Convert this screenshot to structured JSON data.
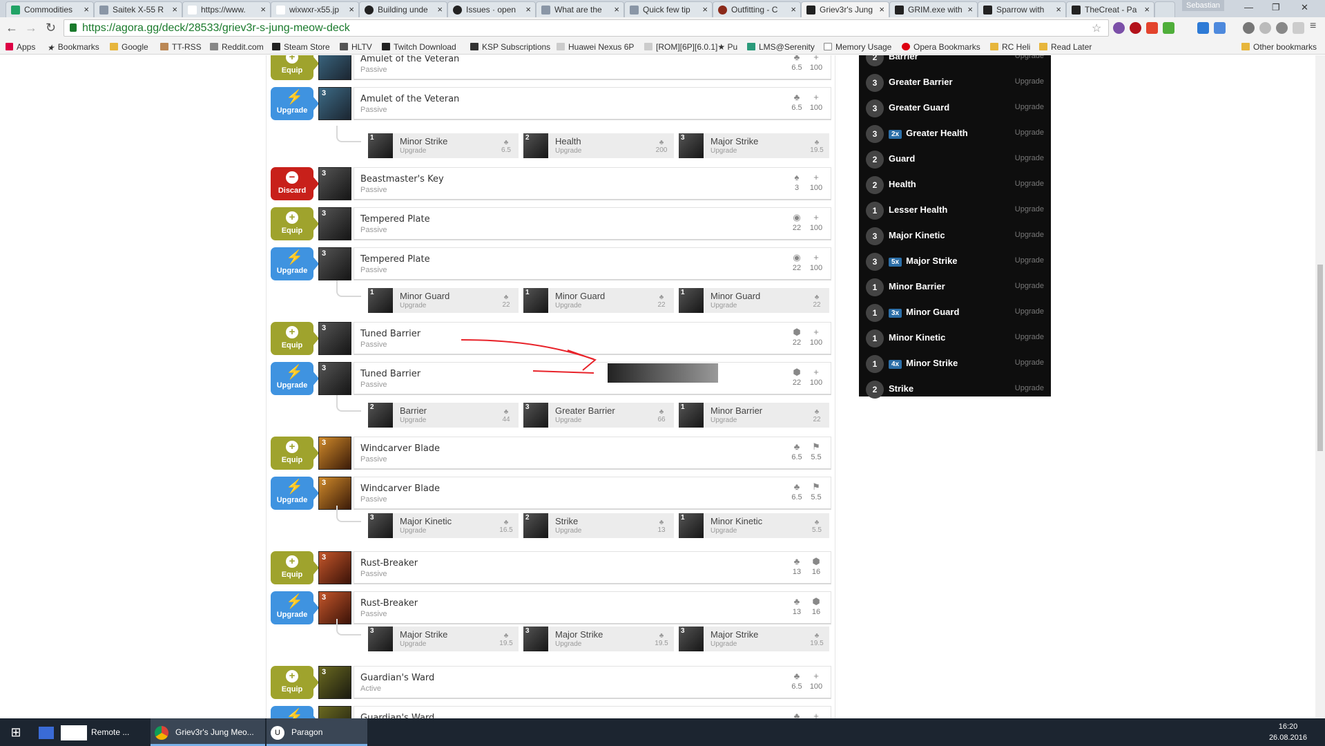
{
  "browser": {
    "tabs": [
      {
        "title": "Commodities"
      },
      {
        "title": "Saitek X-55 R"
      },
      {
        "title": "https://www."
      },
      {
        "title": "wixwxr-x55.jp"
      },
      {
        "title": "Building unde"
      },
      {
        "title": "Issues · open"
      },
      {
        "title": "What are the"
      },
      {
        "title": "Quick few tip"
      },
      {
        "title": "Outfitting - C"
      },
      {
        "title": "Griev3r's Jung"
      },
      {
        "title": "GRIM.exe with"
      },
      {
        "title": "Sparrow with"
      },
      {
        "title": "TheCreat - Pa"
      }
    ],
    "profile_name": "Sebastian",
    "url": "https://agora.gg/deck/28533/griev3r-s-jung-meow-deck",
    "bookmarks": [
      {
        "label": "Apps"
      },
      {
        "label": "Bookmarks"
      },
      {
        "label": "Google"
      },
      {
        "label": "TT-RSS"
      },
      {
        "label": "Reddit.com"
      },
      {
        "label": "Steam Store"
      },
      {
        "label": "HLTV"
      },
      {
        "label": "Twitch Download"
      },
      {
        "label": "KSP Subscriptions"
      },
      {
        "label": "Huawei Nexus 6P"
      },
      {
        "label": "[ROM][6P][6.0.1]★ Pu"
      },
      {
        "label": "LMS@Serenity"
      },
      {
        "label": "Memory Usage"
      },
      {
        "label": "Opera Bookmarks"
      },
      {
        "label": "RC Heli"
      },
      {
        "label": "Read Later"
      }
    ],
    "other_bookmarks": "Other bookmarks"
  },
  "actions": {
    "equip": "Equip",
    "upgrade": "Upgrade",
    "discard": "Discard"
  },
  "cards": [
    {
      "action": "equip",
      "name": "Amulet of the Veteran",
      "type": "Passive",
      "cost": "3",
      "stat1": "6.5",
      "stat2": "100",
      "icon1": "♣",
      "icon2": "+"
    },
    {
      "action": "upgrade",
      "name": "Amulet of the Veteran",
      "type": "Passive",
      "cost": "3",
      "stat1": "6.5",
      "stat2": "100",
      "icon1": "♣",
      "icon2": "+"
    },
    {
      "action": "discard",
      "name": "Beastmaster's Key",
      "type": "Passive",
      "cost": "3",
      "stat1": "3",
      "stat2": "100",
      "icon1": "♠",
      "icon2": "+"
    },
    {
      "action": "equip",
      "name": "Tempered Plate",
      "type": "Passive",
      "cost": "3",
      "stat1": "22",
      "stat2": "100",
      "icon1": "◉",
      "icon2": "+"
    },
    {
      "action": "upgrade",
      "name": "Tempered Plate",
      "type": "Passive",
      "cost": "3",
      "stat1": "22",
      "stat2": "100",
      "icon1": "◉",
      "icon2": "+"
    },
    {
      "action": "equip",
      "name": "Tuned Barrier",
      "type": "Passive",
      "cost": "3",
      "stat1": "22",
      "stat2": "100",
      "icon1": "⬢",
      "icon2": "+"
    },
    {
      "action": "upgrade",
      "name": "Tuned Barrier",
      "type": "Passive",
      "cost": "3",
      "stat1": "22",
      "stat2": "100",
      "icon1": "⬢",
      "icon2": "+"
    },
    {
      "action": "equip",
      "name": "Windcarver Blade",
      "type": "Passive",
      "cost": "3",
      "stat1": "6.5",
      "stat2": "5.5",
      "icon1": "♣",
      "icon2": "⚑"
    },
    {
      "action": "upgrade",
      "name": "Windcarver Blade",
      "type": "Passive",
      "cost": "3",
      "stat1": "6.5",
      "stat2": "5.5",
      "icon1": "♣",
      "icon2": "⚑"
    },
    {
      "action": "equip",
      "name": "Rust-Breaker",
      "type": "Passive",
      "cost": "3",
      "stat1": "13",
      "stat2": "16",
      "icon1": "♣",
      "icon2": "⬢"
    },
    {
      "action": "upgrade",
      "name": "Rust-Breaker",
      "type": "Passive",
      "cost": "3",
      "stat1": "13",
      "stat2": "16",
      "icon1": "♣",
      "icon2": "⬢"
    },
    {
      "action": "equip",
      "name": "Guardian's Ward",
      "type": "Active",
      "cost": "3",
      "stat1": "6.5",
      "stat2": "100",
      "icon1": "♣",
      "icon2": "+"
    },
    {
      "action": "upgrade",
      "name": "Guardian's Ward",
      "type": "",
      "cost": "",
      "stat1": "",
      "stat2": "",
      "icon1": "♣",
      "icon2": "+"
    }
  ],
  "upgrade_rows": [
    {
      "slots": [
        {
          "cost": "1",
          "name": "Minor Strike",
          "type": "Upgrade",
          "value": "6.5"
        },
        {
          "cost": "2",
          "name": "Health",
          "type": "Upgrade",
          "value": "200"
        },
        {
          "cost": "3",
          "name": "Major Strike",
          "type": "Upgrade",
          "value": "19.5"
        }
      ]
    },
    {
      "slots": [
        {
          "cost": "1",
          "name": "Minor Guard",
          "type": "Upgrade",
          "value": "22"
        },
        {
          "cost": "1",
          "name": "Minor Guard",
          "type": "Upgrade",
          "value": "22"
        },
        {
          "cost": "1",
          "name": "Minor Guard",
          "type": "Upgrade",
          "value": "22"
        }
      ]
    },
    {
      "slots": [
        {
          "cost": "2",
          "name": "Barrier",
          "type": "Upgrade",
          "value": "44"
        },
        {
          "cost": "3",
          "name": "Greater Barrier",
          "type": "Upgrade",
          "value": "66"
        },
        {
          "cost": "1",
          "name": "Minor Barrier",
          "type": "Upgrade",
          "value": "22"
        }
      ]
    },
    {
      "slots": [
        {
          "cost": "3",
          "name": "Major Kinetic",
          "type": "Upgrade",
          "value": "16.5"
        },
        {
          "cost": "2",
          "name": "Strike",
          "type": "Upgrade",
          "value": "13"
        },
        {
          "cost": "1",
          "name": "Minor Kinetic",
          "type": "Upgrade",
          "value": "5.5"
        }
      ]
    },
    {
      "slots": [
        {
          "cost": "3",
          "name": "Major Strike",
          "type": "Upgrade",
          "value": "19.5"
        },
        {
          "cost": "3",
          "name": "Major Strike",
          "type": "Upgrade",
          "value": "19.5"
        },
        {
          "cost": "3",
          "name": "Major Strike",
          "type": "Upgrade",
          "value": "19.5"
        }
      ]
    }
  ],
  "sidebar": {
    "items": [
      {
        "level": "2",
        "count": "",
        "name": "Barrier",
        "label": "Upgrade"
      },
      {
        "level": "3",
        "count": "",
        "name": "Greater Barrier",
        "label": "Upgrade"
      },
      {
        "level": "3",
        "count": "",
        "name": "Greater Guard",
        "label": "Upgrade"
      },
      {
        "level": "3",
        "count": "2x",
        "name": "Greater Health",
        "label": "Upgrade"
      },
      {
        "level": "2",
        "count": "",
        "name": "Guard",
        "label": "Upgrade"
      },
      {
        "level": "2",
        "count": "",
        "name": "Health",
        "label": "Upgrade"
      },
      {
        "level": "1",
        "count": "",
        "name": "Lesser Health",
        "label": "Upgrade"
      },
      {
        "level": "3",
        "count": "",
        "name": "Major Kinetic",
        "label": "Upgrade"
      },
      {
        "level": "3",
        "count": "5x",
        "name": "Major Strike",
        "label": "Upgrade"
      },
      {
        "level": "1",
        "count": "",
        "name": "Minor Barrier",
        "label": "Upgrade"
      },
      {
        "level": "1",
        "count": "3x",
        "name": "Minor Guard",
        "label": "Upgrade"
      },
      {
        "level": "1",
        "count": "",
        "name": "Minor Kinetic",
        "label": "Upgrade"
      },
      {
        "level": "1",
        "count": "4x",
        "name": "Minor Strike",
        "label": "Upgrade"
      },
      {
        "level": "2",
        "count": "",
        "name": "Strike",
        "label": "Upgrade"
      }
    ]
  },
  "taskbar": {
    "items": [
      {
        "label": "Remote ..."
      },
      {
        "label": "Griev3r's Jung Meo..."
      },
      {
        "label": "Paragon"
      }
    ],
    "time": "16:20",
    "date": "26.08.2016"
  },
  "colors": {
    "equip": "#9fa32d",
    "upgrade": "#3f93e0",
    "discard": "#c8201a",
    "annotation": "#e8232a"
  }
}
